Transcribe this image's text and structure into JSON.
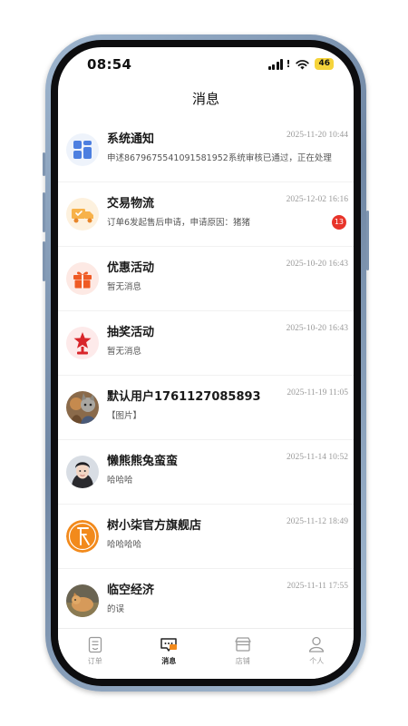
{
  "status_bar": {
    "time": "08:54",
    "battery": "46"
  },
  "header": {
    "title": "消息"
  },
  "messages": [
    {
      "name": "系统通知",
      "time": "2025-11-20 10:44",
      "preview": "申述8679675541091581952系统审核已通过，正在处理",
      "icon": "system-notice-icon"
    },
    {
      "name": "交易物流",
      "time": "2025-12-02 16:16",
      "preview": "订单6发起售后申请，申请原因：猪猪",
      "badge": "13",
      "icon": "truck-icon"
    },
    {
      "name": "优惠活动",
      "time": "2025-10-20 16:43",
      "preview": "暂无消息",
      "icon": "gift-icon"
    },
    {
      "name": "抽奖活动",
      "time": "2025-10-20 16:43",
      "preview": "暂无消息",
      "icon": "lottery-icon"
    },
    {
      "name": "默认用户1761127085893",
      "time": "2025-11-19 11:05",
      "preview": "【图片】",
      "icon": "user-avatar"
    },
    {
      "name": "懒熊熊兔蛮蛮",
      "time": "2025-11-14 10:52",
      "preview": "哈哈哈",
      "icon": "user-avatar"
    },
    {
      "name": "树小柒官方旗舰店",
      "time": "2025-11-12 18:49",
      "preview": "哈哈哈哈",
      "icon": "store-avatar"
    },
    {
      "name": "临空经济",
      "time": "2025-11-11 17:55",
      "preview": "的误",
      "icon": "user-avatar"
    }
  ],
  "tabs": [
    {
      "label": "订单",
      "icon": "order-icon",
      "active": false
    },
    {
      "label": "消息",
      "icon": "message-icon",
      "active": true
    },
    {
      "label": "店铺",
      "icon": "shop-icon",
      "active": false
    },
    {
      "label": "个人",
      "icon": "person-icon",
      "active": false
    }
  ],
  "colors": {
    "accent": "#f28a1c",
    "badge": "#e8342a",
    "system_icon": "#4d7fe0"
  }
}
